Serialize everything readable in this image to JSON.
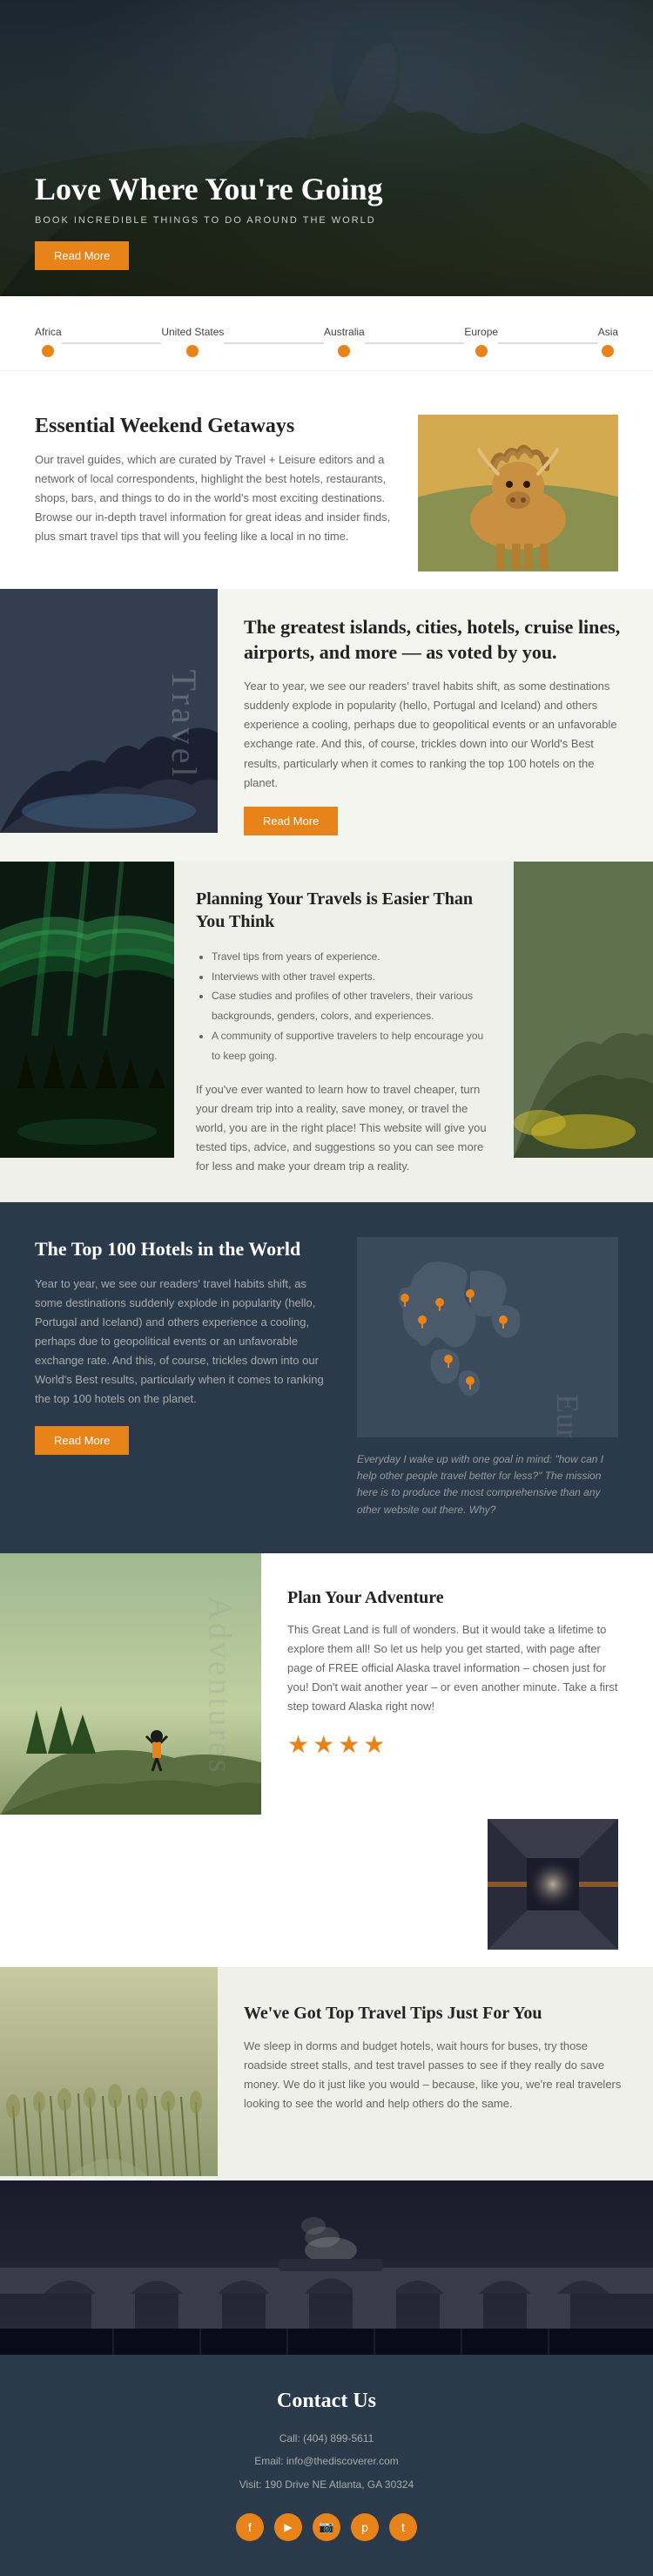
{
  "hero": {
    "title": "Love Where You're Going",
    "subtitle": "BOOK INCREDIBLE THINGS TO DO AROUND THE WORLD",
    "cta_label": "Read More"
  },
  "nav": {
    "items": [
      {
        "label": "Africa"
      },
      {
        "label": "United States"
      },
      {
        "label": "Australia"
      },
      {
        "label": "Europe"
      },
      {
        "label": "Asia"
      }
    ]
  },
  "weekend": {
    "title": "Essential Weekend Getaways",
    "body": "Our travel guides, which are curated by Travel + Leisure editors and a network of local correspondents, highlight the best hotels, restaurants, shops, bars, and things to do in the world's most exciting destinations. Browse our in-depth travel information for great ideas and insider finds, plus smart travel tips that will you feeling like a local in no time."
  },
  "travel": {
    "label": "Travel",
    "title": "The greatest islands, cities, hotels, cruise lines, airports, and more — as voted by you.",
    "body": "Year to year, we see our readers' travel habits shift, as some destinations suddenly explode in popularity (hello, Portugal and Iceland) and others experience a cooling, perhaps due to geopolitical events or an unfavorable exchange rate. And this, of course, trickles down into our World's Best results, particularly when it comes to ranking the top 100 hotels on the planet.",
    "cta_label": "Read More"
  },
  "planning": {
    "title": "Planning Your Travels is Easier Than You Think",
    "bullets": [
      "Travel tips from years of experience.",
      "Interviews with other travel experts.",
      "Case studies and profiles of other travelers, their various backgrounds, genders, colors, and experiences.",
      "A community of supportive travelers to help encourage you to keep going."
    ],
    "body": "If you've ever wanted to learn how to travel cheaper, turn your dream trip into a reality, save money, or travel the world, you are in the right place! This website will give you tested tips, advice, and suggestions so you can see more for less and make your dream trip a reality."
  },
  "top100": {
    "title": "The Top 100 Hotels in the World",
    "body": "Year to year, we see our readers' travel habits shift, as some destinations suddenly explode in popularity (hello, Portugal and Iceland) and others experience a cooling, perhaps due to geopolitical events or an unfavorable exchange rate. And this, of course, trickles down into our World's Best results, particularly when it comes to ranking the top 100 hotels on the planet.",
    "cta_label": "Read More",
    "map_label": "Europe",
    "quote": "Everyday I wake up with one goal in mind: \"how can I help other people travel better for less?\" The mission here is to produce the most comprehensive than any other website out there. Why?"
  },
  "adventure": {
    "title": "Plan Your Adventure",
    "body": "This Great Land is full of wonders. But it would take a lifetime to explore them all! So let us help you get started, with page after page of FREE official Alaska travel information – chosen just for you! Don't wait another year – or even another minute. Take a first step toward Alaska right now!",
    "stars": "★★★★",
    "label": "Adventures"
  },
  "tips": {
    "title": "We've Got Top Travel Tips Just For You",
    "body": "We sleep in dorms and budget hotels, wait hours for buses, try those roadside street stalls, and test travel passes to see if they really do save money. We do it just like you would – because, like you, we're real travelers looking to see the world and help others do the same."
  },
  "contact": {
    "title": "Contact Us",
    "phone": "Call: (404) 899-5611",
    "email": "Email: info@thediscoverer.com",
    "address": "Visit: 190 Drive NE Atlanta, GA 30324",
    "social": [
      "f",
      "y",
      "p",
      "t"
    ]
  }
}
